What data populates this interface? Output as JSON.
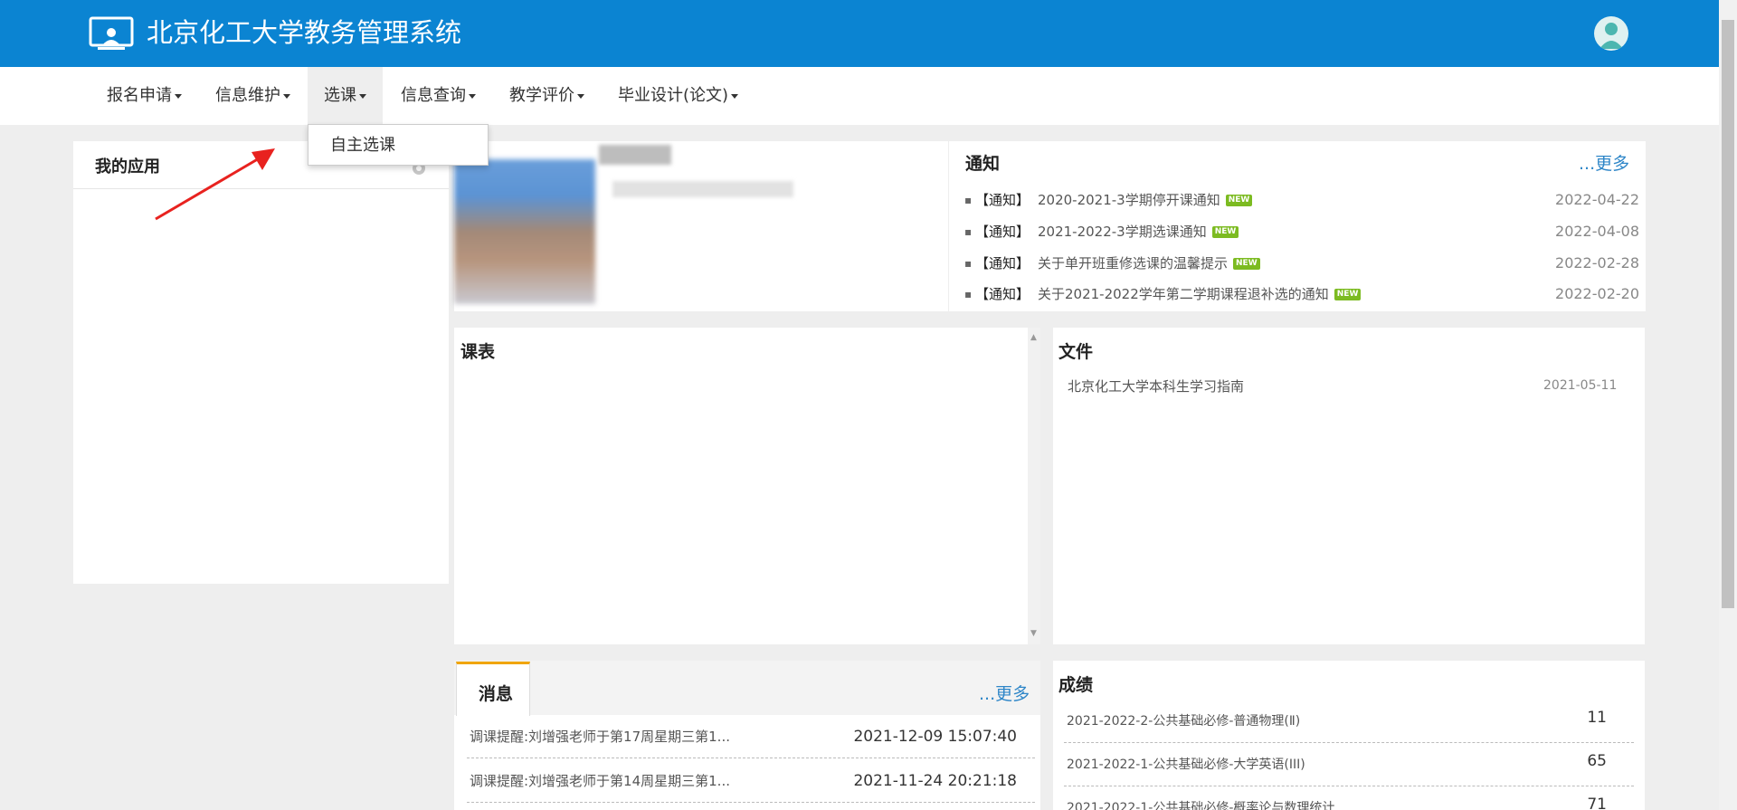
{
  "header": {
    "title": "北京化工大学教务管理系统",
    "brand_color": "#0b84d2"
  },
  "nav": {
    "items": [
      "报名申请",
      "信息维护",
      "选课",
      "信息查询",
      "教学评价",
      "毕业设计(论文)"
    ],
    "active": "选课",
    "dropdown_item": "自主选课"
  },
  "my_apps": {
    "title": "我的应用"
  },
  "notice": {
    "title": "通知",
    "more": "...更多",
    "items": [
      {
        "tag": "【通知】",
        "text": "2020-2021-3学期停开课通知",
        "badge": "NEW",
        "date": "2022-04-22"
      },
      {
        "tag": "【通知】",
        "text": "2021-2022-3学期选课通知",
        "badge": "NEW",
        "date": "2022-04-08"
      },
      {
        "tag": "【通知】",
        "text": "关于单开班重修选课的温馨提示",
        "badge": "NEW",
        "date": "2022-02-28"
      },
      {
        "tag": "【通知】",
        "text": "关于2021-2022学年第二学期课程退补选的通知",
        "badge": "NEW",
        "date": "2022-02-20"
      }
    ]
  },
  "schedule": {
    "title": "课表"
  },
  "files": {
    "title": "文件",
    "items": [
      {
        "name": "北京化工大学本科生学习指南",
        "date": "2021-05-11"
      }
    ]
  },
  "messages": {
    "tab": "消息",
    "more": "...更多",
    "items": [
      {
        "text": "调课提醒:刘增强老师于第17周星期三第1...",
        "time": "2021-12-09 15:07:40"
      },
      {
        "text": "调课提醒:刘增强老师于第14周星期三第1...",
        "time": "2021-11-24 20:21:18"
      }
    ]
  },
  "grades": {
    "title": "成绩",
    "items": [
      {
        "course": "2021-2022-2-公共基础必修-普通物理(Ⅱ)",
        "score": "11"
      },
      {
        "course": "2021-2022-1-公共基础必修-大学英语(III)",
        "score": "65"
      },
      {
        "course": "2021-2022-1-公共基础必修-概率论与数理统计",
        "score": "71"
      }
    ]
  }
}
